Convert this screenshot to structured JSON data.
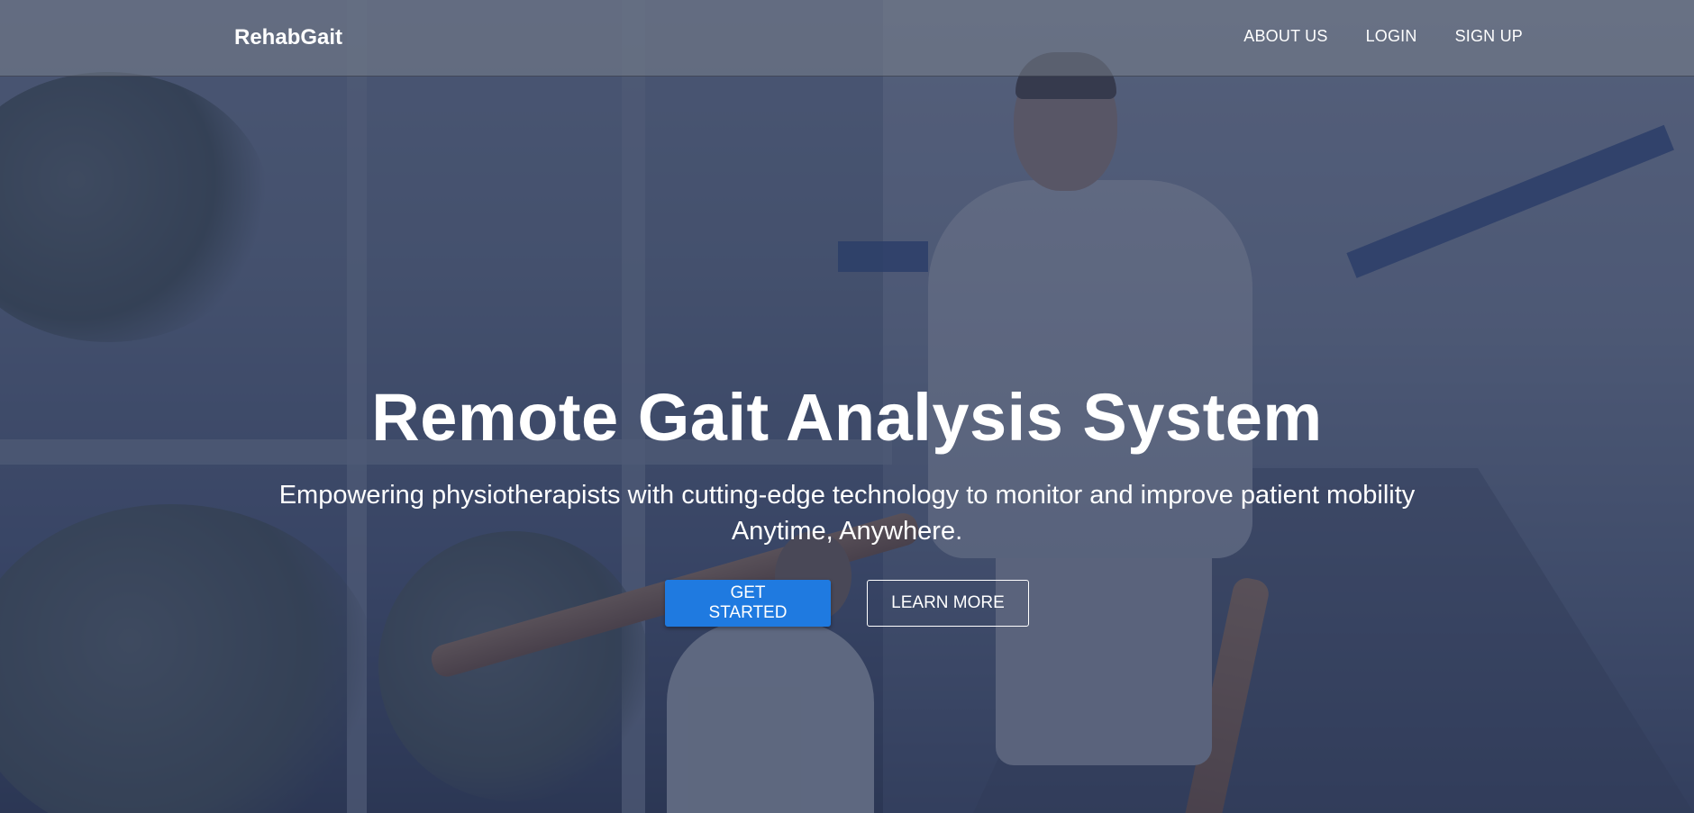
{
  "navbar": {
    "brand": "RehabGait",
    "links": [
      "ABOUT US",
      "LOGIN",
      "SIGN UP"
    ]
  },
  "hero": {
    "title": "Remote Gait Analysis System",
    "subtitle_line1": "Empowering physiotherapists with cutting-edge technology to monitor and improve patient mobility",
    "subtitle_line2": "Anytime, Anywhere.",
    "primary_button": "GET STARTED",
    "secondary_button": "LEARN MORE"
  },
  "colors": {
    "primary_button": "#1f7ae0",
    "overlay": "#202a48",
    "text": "#ffffff"
  }
}
